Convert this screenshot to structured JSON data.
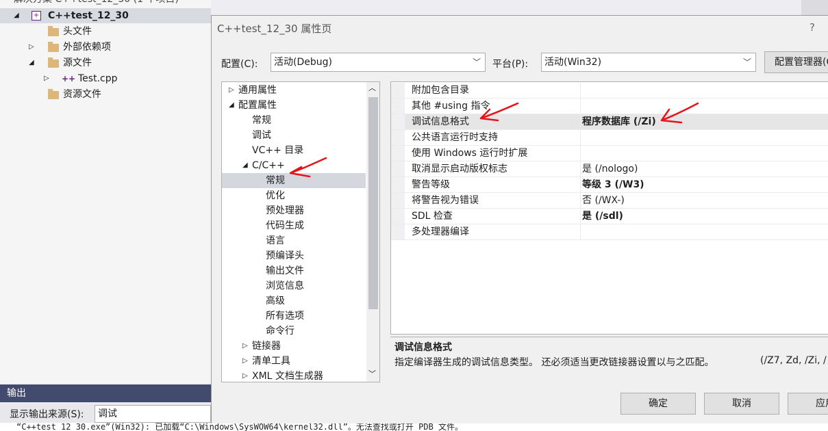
{
  "solution_explorer": {
    "header_partial": "解决方案 C++test_12_30 (1 个项目)",
    "project": "C++test_12_30",
    "items": [
      {
        "label": "头文件"
      },
      {
        "label": "外部依赖项"
      },
      {
        "label": "源文件"
      },
      {
        "label": "Test.cpp"
      },
      {
        "label": "资源文件"
      }
    ]
  },
  "output": {
    "title": "输出",
    "source_label": "显示输出来源(S):",
    "source_value": "调试",
    "text": "“C++test_12_30.exe”(Win32): 已加载“C:\\Windows\\SysWOW64\\kernel32.dll”。无法查找或打开 PDB 文件。"
  },
  "dialog": {
    "title": "C++test_12_30 属性页",
    "help": "?",
    "config_label": "配置(C):",
    "config_value": "活动(Debug)",
    "platform_label": "平台(P):",
    "platform_value": "活动(Win32)",
    "config_manager": "配置管理器(O)...",
    "tree": [
      {
        "label": "通用属性",
        "level": 0,
        "expander": "▷"
      },
      {
        "label": "配置属性",
        "level": 0,
        "expander": "◢"
      },
      {
        "label": "常规",
        "level": 1,
        "expander": ""
      },
      {
        "label": "调试",
        "level": 1,
        "expander": ""
      },
      {
        "label": "VC++ 目录",
        "level": 1,
        "expander": ""
      },
      {
        "label": "C/C++",
        "level": 1,
        "expander": "◢"
      },
      {
        "label": "常规",
        "level": 2,
        "expander": "",
        "selected": true
      },
      {
        "label": "优化",
        "level": 2,
        "expander": ""
      },
      {
        "label": "预处理器",
        "level": 2,
        "expander": ""
      },
      {
        "label": "代码生成",
        "level": 2,
        "expander": ""
      },
      {
        "label": "语言",
        "level": 2,
        "expander": ""
      },
      {
        "label": "预编译头",
        "level": 2,
        "expander": ""
      },
      {
        "label": "输出文件",
        "level": 2,
        "expander": ""
      },
      {
        "label": "浏览信息",
        "level": 2,
        "expander": ""
      },
      {
        "label": "高级",
        "level": 2,
        "expander": ""
      },
      {
        "label": "所有选项",
        "level": 2,
        "expander": ""
      },
      {
        "label": "命令行",
        "level": 2,
        "expander": ""
      },
      {
        "label": "链接器",
        "level": 1,
        "expander": "▷"
      },
      {
        "label": "清单工具",
        "level": 1,
        "expander": "▷"
      },
      {
        "label": "XML 文档生成器",
        "level": 1,
        "expander": "▷"
      }
    ],
    "properties": [
      {
        "name": "附加包含目录",
        "value": "",
        "bold": false
      },
      {
        "name": "其他 #using 指令",
        "value": "",
        "bold": false
      },
      {
        "name": "调试信息格式",
        "value": "程序数据库 (/Zi)",
        "bold": true,
        "selected": true
      },
      {
        "name": "公共语言运行时支持",
        "value": "",
        "bold": false
      },
      {
        "name": "使用 Windows 运行时扩展",
        "value": "",
        "bold": false
      },
      {
        "name": "取消显示启动版权标志",
        "value": "是 (/nologo)",
        "bold": false
      },
      {
        "name": "警告等级",
        "value": "等级 3 (/W3)",
        "bold": true
      },
      {
        "name": "将警告视为错误",
        "value": "否 (/WX-)",
        "bold": false
      },
      {
        "name": "SDL 检查",
        "value": "是 (/sdl)",
        "bold": true
      },
      {
        "name": "多处理器编译",
        "value": "",
        "bold": false
      }
    ],
    "description_title": "调试信息格式",
    "description_text": "指定编译器生成的调试信息类型。 还必须适当更改链接器设置以与之匹配。",
    "description_switches": "(/Z7, Zd, /Zi, /",
    "ok": "确定",
    "cancel": "取消",
    "apply": "应用"
  },
  "colors": {
    "annotation_arrow": "#e8121b",
    "output_title_bg": "#424b6e"
  }
}
